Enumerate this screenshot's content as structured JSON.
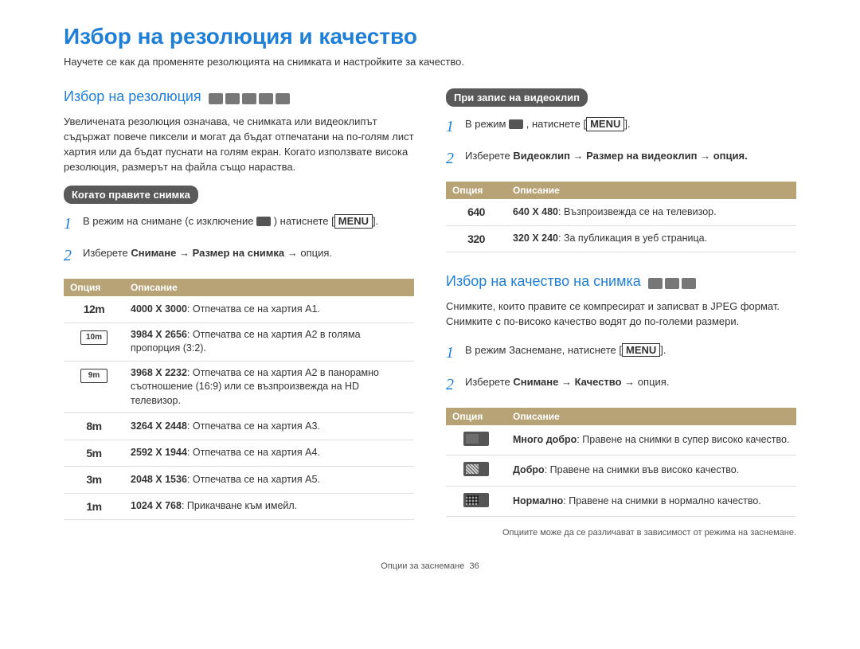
{
  "page_title": "Избор на резолюция и качество",
  "page_intro": "Научете се как да променяте резолюцията на снимката и настройките за качество.",
  "footer": {
    "section": "Опции за заснемане",
    "page": "36"
  },
  "menu_label": "MENU",
  "left": {
    "heading": "Избор на резолюция",
    "desc": "Увеличената резолюция означава, че снимката или видеоклипът съдържат повече пиксели и могат да бъдат отпечатани на по-голям лист хартия или да бъдат пуснати на голям екран. Когато използвате висока резолюция, размерът на файла също нараства.",
    "subhead": "Когато правите снимка",
    "step1_a": "В режим на снимане (с изключение ",
    "step1_b": ") натиснете ",
    "step1_c": ".",
    "step2_a": "Изберете ",
    "step2_b": "Снимане → Размер на снимка →",
    "step2_c": " опция.",
    "table_h1": "Опция",
    "table_h2": "Описание",
    "rows": [
      {
        "badge": "12m",
        "res": "4000 X 3000",
        "text": ": Отпечатва се на хартия A1."
      },
      {
        "badge": "10m",
        "res": "3984 X 2656",
        "text": ": Отпечатва се на хартия A2 в голяма пропорция (3:2)."
      },
      {
        "badge": "9m",
        "res": "3968 X 2232",
        "text": ": Отпечатва се на хартия A2 в панорамно съотношение (16:9) или се възпроизвежда на HD телевизор."
      },
      {
        "badge": "8m",
        "res": "3264 X 2448",
        "text": ": Отпечатва се на хартия A3."
      },
      {
        "badge": "5m",
        "res": "2592 X 1944",
        "text": ": Отпечатва се на хартия A4."
      },
      {
        "badge": "3m",
        "res": "2048 X 1536",
        "text": ": Отпечатва се на хартия A5."
      },
      {
        "badge": "1m",
        "res": "1024 X 768",
        "text": ": Прикачване към имейл."
      }
    ]
  },
  "right_top": {
    "subhead": "При запис на видеоклип",
    "step1_a": "В режим ",
    "step1_b": ", натиснете ",
    "step1_c": ".",
    "step2_a": "Изберете ",
    "step2_b": "Видеоклип → Размер на видеоклип →",
    "step2_c": " опция.",
    "table_h1": "Опция",
    "table_h2": "Описание",
    "rows": [
      {
        "badge": "640",
        "res": "640 X 480",
        "text": ": Възпроизвежда се на телевизор."
      },
      {
        "badge": "320",
        "res": "320 X 240",
        "text": ": За публикация в уеб страница."
      }
    ]
  },
  "right_bottom": {
    "heading": "Избор на качество на снимка",
    "desc": "Снимките, които правите се компресират и записват в JPEG формат. Снимките с по-високо качество водят до по-големи размери.",
    "step1_a": "В режим Заснемане, натиснете ",
    "step1_b": ".",
    "step2_a": "Изберете ",
    "step2_b": "Снимане → Качество →",
    "step2_c": " опция.",
    "table_h1": "Опция",
    "table_h2": "Описание",
    "rows": [
      {
        "qclass": "qfine",
        "label": "Много добро",
        "text": ": Правене на снимки в супер високо качество."
      },
      {
        "qclass": "qgood",
        "label": "Добро",
        "text": ": Правене на снимки във високо качество."
      },
      {
        "qclass": "qnorm",
        "label": "Нормално",
        "text": ": Правене на снимки в нормално качество."
      }
    ],
    "footnote": "Опциите може да се различават в зависимост от режима на заснемане."
  }
}
